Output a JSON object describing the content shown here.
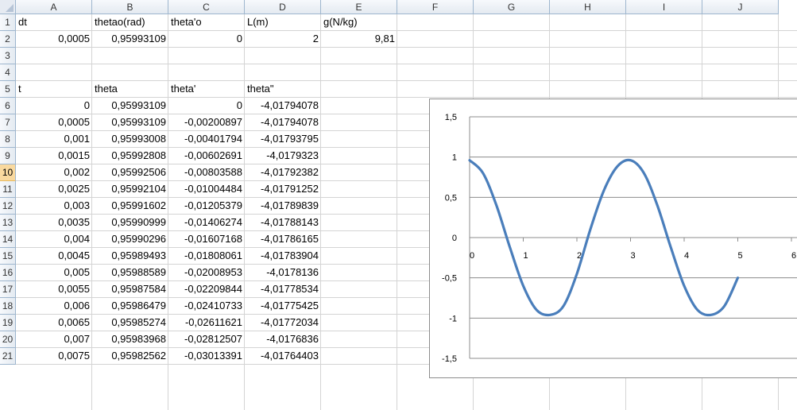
{
  "columns": [
    "A",
    "B",
    "C",
    "D",
    "E",
    "F",
    "G",
    "H",
    "I",
    "J"
  ],
  "rows": [
    "1",
    "2",
    "3",
    "4",
    "5",
    "6",
    "7",
    "8",
    "9",
    "10",
    "11",
    "12",
    "13",
    "14",
    "15",
    "16",
    "17",
    "18",
    "19",
    "20",
    "21"
  ],
  "selected_row": "10",
  "params": {
    "headers": [
      "dt",
      "thetao(rad)",
      "theta'o",
      "L(m)",
      "g(N/kg)"
    ],
    "values": [
      "0,0005",
      "0,95993109",
      "0",
      "2",
      "9,81"
    ]
  },
  "table": {
    "headers": [
      "t",
      "theta",
      "theta'",
      "theta\""
    ],
    "rows": [
      [
        "0",
        "0,95993109",
        "0",
        "-4,01794078"
      ],
      [
        "0,0005",
        "0,95993109",
        "-0,00200897",
        "-4,01794078"
      ],
      [
        "0,001",
        "0,95993008",
        "-0,00401794",
        "-4,01793795"
      ],
      [
        "0,0015",
        "0,95992808",
        "-0,00602691",
        "-4,0179323"
      ],
      [
        "0,002",
        "0,95992506",
        "-0,00803588",
        "-4,01792382"
      ],
      [
        "0,0025",
        "0,95992104",
        "-0,01004484",
        "-4,01791252"
      ],
      [
        "0,003",
        "0,95991602",
        "-0,01205379",
        "-4,01789839"
      ],
      [
        "0,0035",
        "0,95990999",
        "-0,01406274",
        "-4,01788143"
      ],
      [
        "0,004",
        "0,95990296",
        "-0,01607168",
        "-4,01786165"
      ],
      [
        "0,0045",
        "0,95989493",
        "-0,01808061",
        "-4,01783904"
      ],
      [
        "0,005",
        "0,95988589",
        "-0,02008953",
        "-4,0178136"
      ],
      [
        "0,0055",
        "0,95987584",
        "-0,02209844",
        "-4,01778534"
      ],
      [
        "0,006",
        "0,95986479",
        "-0,02410733",
        "-4,01775425"
      ],
      [
        "0,0065",
        "0,95985274",
        "-0,02611621",
        "-4,01772034"
      ],
      [
        "0,007",
        "0,95983968",
        "-0,02812507",
        "-4,0176836"
      ],
      [
        "0,0075",
        "0,95982562",
        "-0,03013391",
        "-4,01764403"
      ]
    ]
  },
  "colors": {
    "line": "#4a7ebb",
    "header_bg": "#e4eaf1",
    "selected_row": "#f9d99f"
  },
  "chart_data": {
    "type": "line",
    "title": "",
    "xlabel": "",
    "ylabel": "",
    "xlim": [
      0,
      6
    ],
    "ylim": [
      -1.5,
      1.5
    ],
    "x_ticks": [
      "0",
      "1",
      "2",
      "3",
      "4",
      "5",
      "6"
    ],
    "y_ticks": [
      "1,5",
      "1",
      "0,5",
      "0",
      "-0,5",
      "-1",
      "-1,5"
    ],
    "grid": "horizontal",
    "legend": "none",
    "series": [
      {
        "x": [
          0,
          0.25,
          0.5,
          0.75,
          1,
          1.25,
          1.5,
          1.75,
          2,
          2.25,
          2.5,
          2.75,
          3,
          3.25,
          3.5,
          3.75,
          4,
          4.25,
          4.5,
          4.75,
          5
        ],
        "y": [
          0.96,
          0.8,
          0.4,
          -0.12,
          -0.6,
          -0.9,
          -0.96,
          -0.85,
          -0.45,
          0.1,
          0.58,
          0.88,
          0.96,
          0.8,
          0.4,
          -0.12,
          -0.6,
          -0.9,
          -0.96,
          -0.85,
          -0.5
        ]
      }
    ]
  }
}
